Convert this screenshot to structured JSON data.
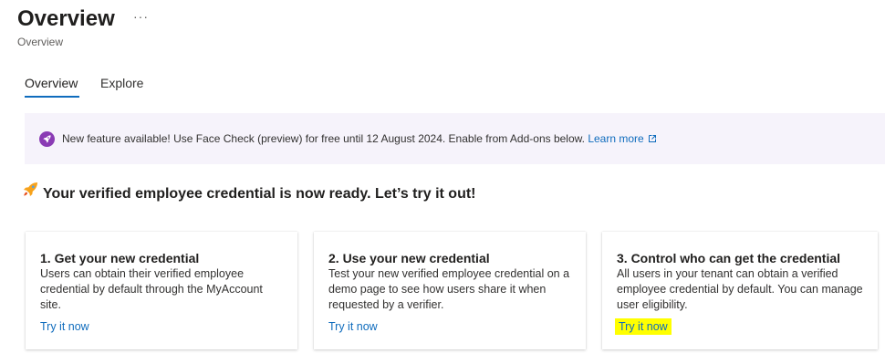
{
  "header": {
    "title": "Overview",
    "more": "···",
    "subtitle": "Overview"
  },
  "tabs": [
    {
      "label": "Overview",
      "selected": true
    },
    {
      "label": "Explore",
      "selected": false
    }
  ],
  "banner": {
    "icon": "rocket-icon",
    "text": "New feature available! Use Face Check (preview) for free until 12 August 2024. Enable from Add-ons below.",
    "link_label": "Learn more",
    "link_icon": "open-external-icon"
  },
  "headline": {
    "icon": "rocket-icon",
    "text": "Your verified employee credential is now ready. Let’s try it out!"
  },
  "cards": [
    {
      "title": "1. Get your new credential",
      "body": "Users can obtain their verified employee credential by default through the MyAccount site.",
      "link": "Try it now",
      "highlighted": false
    },
    {
      "title": "2. Use your new credential",
      "body": "Test your new verified employee credential on a demo page to see how users share it when requested by a verifier.",
      "link": "Try it now",
      "highlighted": false
    },
    {
      "title": "3. Control who can get the credential",
      "body": "All users in your tenant can obtain a verified employee credential by default. You can manage user eligibility.",
      "link": "Try it now",
      "highlighted": true
    }
  ],
  "colors": {
    "accent": "#0f6cbd",
    "banner_background": "#f6f3fb",
    "banner_icon": "#8a3bb4",
    "highlight": "#ffff00"
  }
}
